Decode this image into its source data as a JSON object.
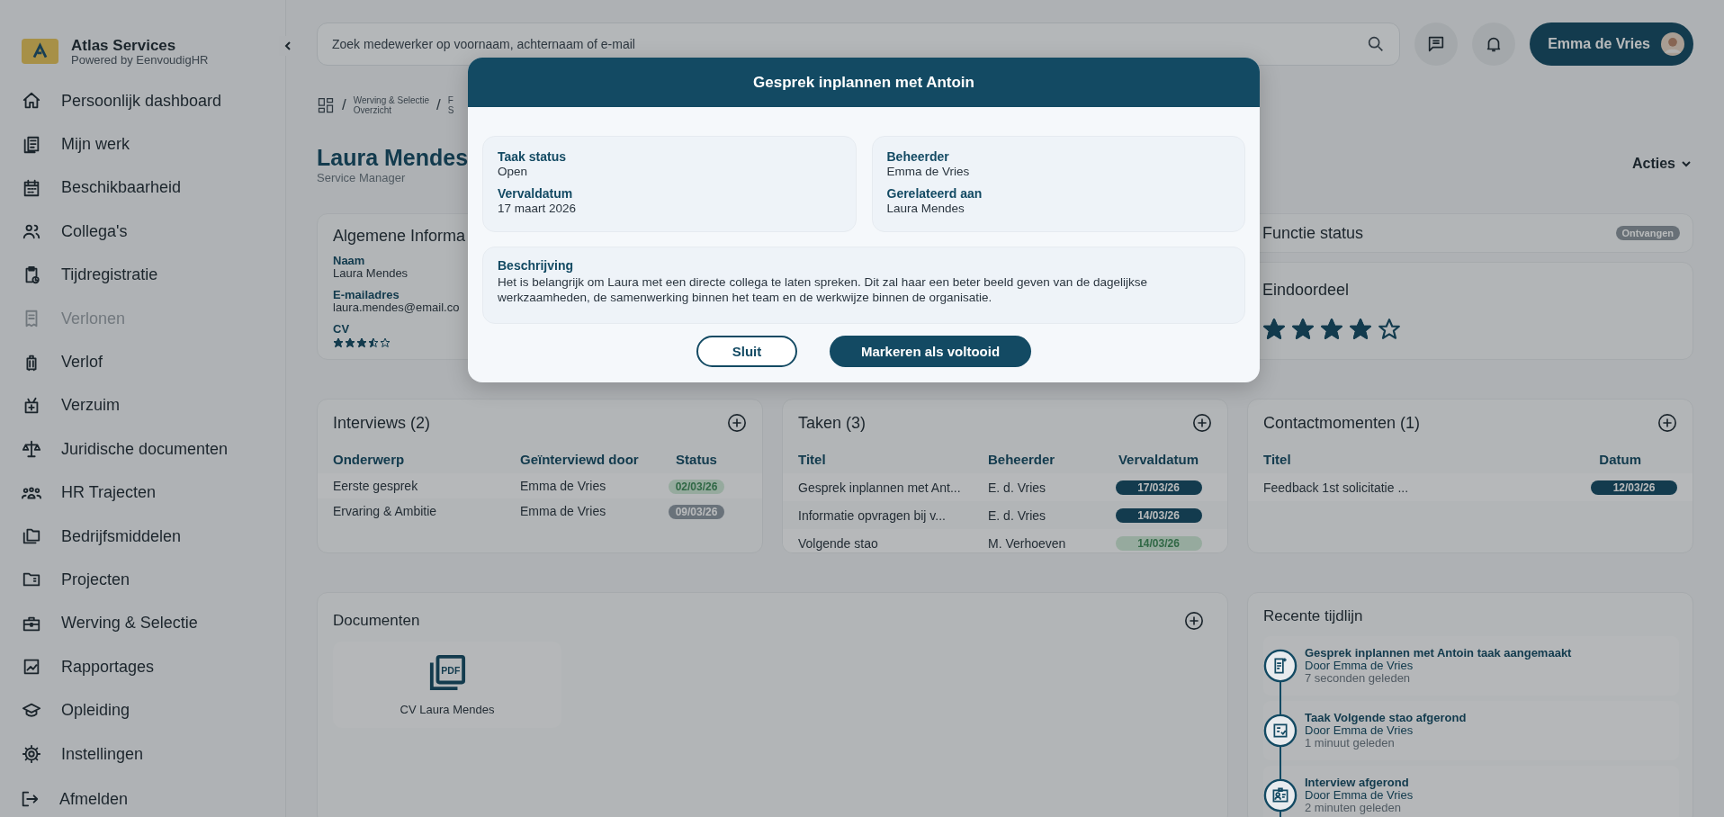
{
  "sidebar": {
    "brand": {
      "name": "Atlas Services",
      "tagline": "Powered by EenvoudigHR"
    },
    "items": [
      {
        "label": "Persoonlijk dashboard",
        "disabled": false
      },
      {
        "label": "Mijn werk",
        "disabled": false
      },
      {
        "label": "Beschikbaarheid",
        "disabled": false
      },
      {
        "label": "Collega's",
        "disabled": false
      },
      {
        "label": "Tijdregistratie",
        "disabled": false
      },
      {
        "label": "Verlonen",
        "disabled": true
      },
      {
        "label": "Verlof",
        "disabled": false
      },
      {
        "label": "Verzuim",
        "disabled": false
      },
      {
        "label": "Juridische documenten",
        "disabled": false
      },
      {
        "label": "HR Trajecten",
        "disabled": false
      },
      {
        "label": "Bedrijfsmiddelen",
        "disabled": false
      },
      {
        "label": "Projecten",
        "disabled": false
      },
      {
        "label": "Werving & Selectie",
        "disabled": false
      },
      {
        "label": "Rapportages",
        "disabled": false
      },
      {
        "label": "Opleiding",
        "disabled": false
      },
      {
        "label": "Instellingen",
        "disabled": false
      }
    ],
    "logout": "Afmelden"
  },
  "topbar": {
    "search": {
      "placeholder": "Zoek medewerker op voornaam, achternaam of e-mail"
    },
    "user": "Emma de Vries"
  },
  "breadcrumb": [
    {
      "separator": "/",
      "line1": "Werving & Selectie",
      "line2": "Overzicht"
    },
    {
      "separator": "/",
      "line1": "F",
      "line2": "S"
    }
  ],
  "header": {
    "name": "Laura Mendes",
    "role": "Service Manager",
    "actions": "Acties"
  },
  "general": {
    "title": "Algemene Informa",
    "fields": [
      {
        "label": "Naam",
        "value": "Laura Mendes"
      },
      {
        "label": "E-mailadres",
        "value": "laura.mendes@email.co"
      }
    ],
    "cv": {
      "label": "CV",
      "stars": 3.5
    }
  },
  "function_status": {
    "title": "Functie status",
    "badge": "Ontvangen"
  },
  "final_rating": {
    "title": "Eindoordeel",
    "stars": 4
  },
  "interviews": {
    "title": "Interviews (2)",
    "columns": [
      "Onderwerp",
      "Geïnterviewd door",
      "Status"
    ],
    "rows": [
      {
        "subject": "Eerste gesprek",
        "by": "Emma de Vries",
        "date": "02/03/26",
        "kind": "done"
      },
      {
        "subject": "Ervaring & Ambitie",
        "by": "Emma de Vries",
        "date": "09/03/26",
        "kind": "past"
      }
    ]
  },
  "tasks": {
    "title": "Taken (3)",
    "columns": [
      "Titel",
      "Beheerder",
      "Vervaldatum"
    ],
    "rows": [
      {
        "subject": "Gesprek inplannen met Ant...",
        "by": "E. d. Vries",
        "date": "17/03/26",
        "kind": "due"
      },
      {
        "subject": "Informatie opvragen bij v...",
        "by": "E. d. Vries",
        "date": "14/03/26",
        "kind": "due"
      },
      {
        "subject": "Volgende stao",
        "by": "M. Verhoeven",
        "date": "14/03/26",
        "kind": "done"
      }
    ]
  },
  "contacts": {
    "title": "Contactmomenten (1)",
    "columns": [
      "Titel",
      "Datum"
    ],
    "rows": [
      {
        "subject": "Feedback 1st solicitatie ...",
        "date": "12/03/26",
        "kind": "due"
      }
    ]
  },
  "documents": {
    "title": "Documenten",
    "files": [
      {
        "icon_label": "PDF",
        "name": "CV Laura Mendes"
      }
    ]
  },
  "timeline": {
    "title": "Recente tijdlijn",
    "events": [
      {
        "kind": "created",
        "title": "Gesprek inplannen met Antoin taak aangemaakt",
        "by": "Door Emma de Vries",
        "time": "7 seconden geleden"
      },
      {
        "kind": "completed",
        "title": "Taak Volgende stao afgerond",
        "by": "Door Emma de Vries",
        "time": "1 minuut geleden"
      },
      {
        "kind": "interview",
        "title": "Interview afgerond",
        "by": "Door Emma de Vries",
        "time": "2 minuten geleden"
      }
    ]
  },
  "modal": {
    "title": "Gesprek inplannen met Antoin",
    "cards": [
      [
        {
          "label": "Taak status",
          "value": "Open"
        },
        {
          "label": "Vervaldatum",
          "value": "17 maart 2026"
        }
      ],
      [
        {
          "label": "Beheerder",
          "value": "Emma de Vries"
        },
        {
          "label": "Gerelateerd aan",
          "value": "Laura Mendes"
        }
      ]
    ],
    "description": {
      "label": "Beschrijving",
      "text": "Het is belangrijk om Laura met een directe collega te laten spreken. Dit zal haar een beter beeld geven van de dagelijkse werkzaamheden, de samenwerking binnen het team en de werkwijze binnen de organisatie."
    },
    "buttons": [
      {
        "label": "Sluit",
        "kind": "secondary"
      },
      {
        "label": "Markeren als voltooid",
        "kind": "primary"
      }
    ]
  }
}
